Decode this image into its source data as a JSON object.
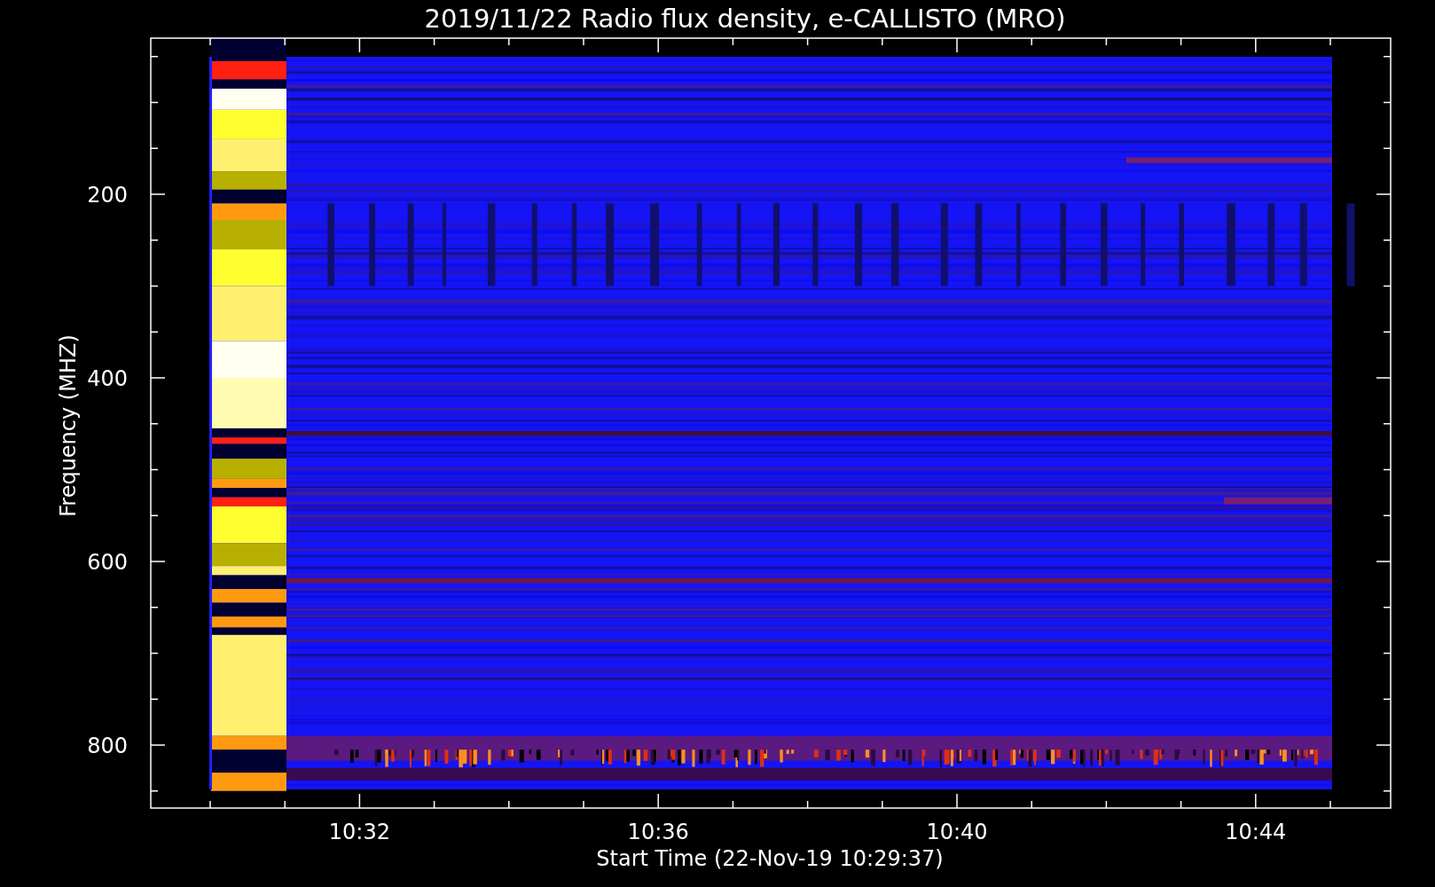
{
  "title": "2019/11/22  Radio flux density, e-CALLISTO (MRO)",
  "y_axis": {
    "label": "Frequency (MHZ)",
    "ticks": [
      "200",
      "400",
      "600",
      "800"
    ]
  },
  "x_axis": {
    "label": "Start Time (22-Nov-19 10:29:37)",
    "ticks": [
      "10:32",
      "10:36",
      "10:40",
      "10:44"
    ]
  }
}
